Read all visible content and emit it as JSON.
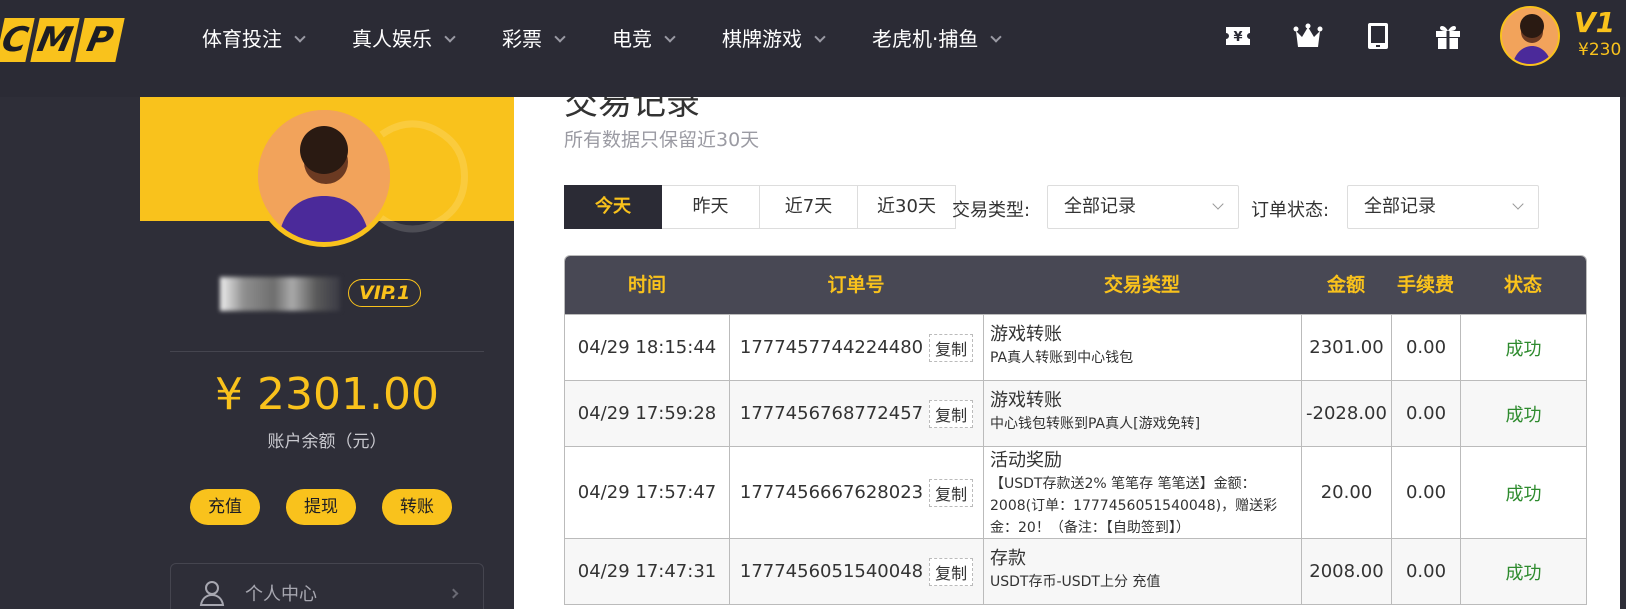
{
  "header": {
    "logo_letters": [
      "C",
      "M",
      "P"
    ],
    "nav": [
      {
        "label": "体育投注"
      },
      {
        "label": "真人娱乐"
      },
      {
        "label": "彩票"
      },
      {
        "label": "电竞"
      },
      {
        "label": "棋牌游戏"
      },
      {
        "label": "老虎机·捕鱼"
      }
    ],
    "icons": [
      "voucher-icon",
      "crown-icon",
      "tablet-icon",
      "gift-icon"
    ],
    "vip": "V1",
    "balance": "¥230"
  },
  "sidebar": {
    "vip_badge": "VIP.1",
    "balance": "¥ 2301.00",
    "balance_label": "账户余额（元）",
    "buttons": {
      "deposit": "充值",
      "withdraw": "提现",
      "transfer": "转账"
    },
    "menu_personal": "个人中心"
  },
  "main": {
    "title": "交易记录",
    "subtitle": "所有数据只保留近30天",
    "tabs": [
      {
        "label": "今天",
        "active": true
      },
      {
        "label": "昨天"
      },
      {
        "label": "近7天"
      },
      {
        "label": "近30天"
      }
    ],
    "filter_type_label": "交易类型:",
    "filter_type_value": "全部记录",
    "filter_status_label": "订单状态:",
    "filter_status_value": "全部记录",
    "table": {
      "headers": [
        "时间",
        "订单号",
        "交易类型",
        "金额",
        "手续费",
        "状态"
      ],
      "copy_label": "复制",
      "rows": [
        {
          "time": "04/29 18:15:44",
          "order": "1777457744224480",
          "type": "游戏转账",
          "detail": "PA真人转账到中心钱包",
          "amount": "2301.00",
          "fee": "0.00",
          "status": "成功"
        },
        {
          "time": "04/29 17:59:28",
          "order": "1777456768772457",
          "type": "游戏转账",
          "detail": "中心钱包转账到PA真人[游戏免转]",
          "amount": "-2028.00",
          "fee": "0.00",
          "status": "成功"
        },
        {
          "time": "04/29 17:57:47",
          "order": "1777456667628023",
          "type": "活动奖励",
          "detail": "【USDT存款送2% 笔笔存 笔笔送】金额：2008(订单：1777456051540048)，赠送彩金：20！（备注：【自助签到】）",
          "amount": "20.00",
          "fee": "0.00",
          "status": "成功"
        },
        {
          "time": "04/29 17:47:31",
          "order": "1777456051540048",
          "type": "存款",
          "detail": "USDT存币-USDT上分 充值",
          "amount": "2008.00",
          "fee": "0.00",
          "status": "成功"
        }
      ]
    }
  },
  "colors": {
    "accent": "#f9c21c",
    "dark": "#2b2b35",
    "success": "#2e8b2e"
  }
}
